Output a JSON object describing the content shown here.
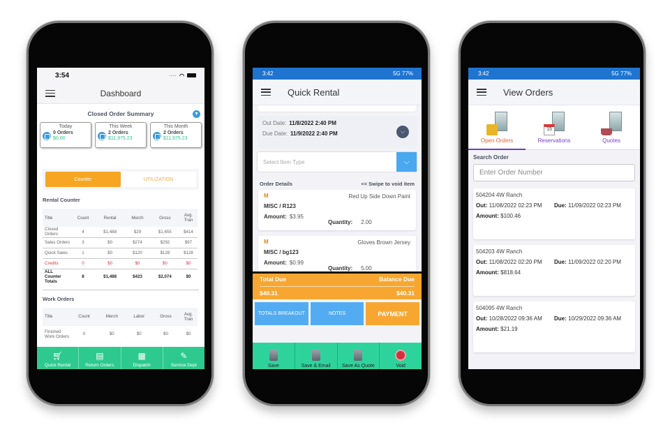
{
  "phone1": {
    "status_time": "3:54",
    "title": "Dashboard",
    "summary_title": "Closed Order Summary",
    "cards": [
      {
        "period": "Today",
        "orders": "0 Orders",
        "amount": "$0.00"
      },
      {
        "period": "This Week",
        "orders": "2 Orders",
        "amount": "$11,975.23"
      },
      {
        "period": "This Month",
        "orders": "2 Orders",
        "amount": "$11,975.23"
      }
    ],
    "segments": {
      "counter": "Counter",
      "utilization": "UTILIZATION"
    },
    "rental_counter": {
      "title": "Rental Counter",
      "headers": [
        "Title",
        "Count",
        "Rental",
        "Merch",
        "Gross",
        "Avg. Tran"
      ],
      "rows": [
        [
          "Closed Orders",
          "4",
          "$1,488",
          "$29",
          "$1,655",
          "$414"
        ],
        [
          "Sales Orders",
          "3",
          "$0",
          "$274",
          "$292",
          "$97"
        ],
        [
          "Quick Sales",
          "1",
          "$0",
          "$120",
          "$128",
          "$128"
        ],
        [
          "Credits",
          "0",
          "$0",
          "$0",
          "$0",
          "$0"
        ],
        [
          "ALL Counter Totals",
          "8",
          "$1,488",
          "$423",
          "$2,074",
          "$0"
        ]
      ]
    },
    "work_orders": {
      "title": "Work Orders",
      "headers": [
        "Title",
        "Count",
        "Merch",
        "Labor",
        "Gross",
        "Avg. Tran"
      ],
      "rows": [
        [
          "Finished Work Orders",
          "0",
          "$0",
          "$0",
          "$0",
          "$0"
        ]
      ]
    },
    "tabbar": [
      {
        "label": "Quick Rental",
        "icon": "cart-icon"
      },
      {
        "label": "Return Orders",
        "icon": "document-icon"
      },
      {
        "label": "Dispatch",
        "icon": "cash-register-icon"
      },
      {
        "label": "Service Dept",
        "icon": "chat-edit-icon"
      }
    ]
  },
  "phone2": {
    "status_time": "3:42",
    "status_right": "5G  77%",
    "title": "Quick Rental",
    "out_date_label": "Out Date:",
    "out_date": "11/8/2022 2:40 PM",
    "due_date_label": "Due Date:",
    "due_date": "11/9/2022 2:40 PM",
    "item_type_placeholder": "Select Item Type",
    "order_details_label": "Order Details",
    "swipe_hint": "<< Swipe to void item",
    "items": [
      {
        "type": "M",
        "name": "Red Up Side Down Paint",
        "sku": "MISC / R123",
        "amount_label": "Amount:",
        "amount": "$3.95",
        "quantity_label": "Quantity:",
        "quantity": "2.00"
      },
      {
        "type": "M",
        "name": "Gloves Brown Jersey",
        "sku": "MISC / bg123",
        "amount_label": "Amount:",
        "amount": "$0.99",
        "quantity_label": "Quantity:",
        "quantity": "5.00"
      }
    ],
    "total_due_label": "Total Due",
    "total_due": "$40.31",
    "balance_due_label": "Balance Due",
    "balance_due": "$40.31",
    "buttons": {
      "totals": "TOTALS BREAKOUT",
      "notes": "NOTES",
      "payment": "PAYMENT"
    },
    "tabbar": [
      {
        "label": "Save"
      },
      {
        "label": "Save & Email"
      },
      {
        "label": "Save As Quote"
      },
      {
        "label": "Void"
      }
    ]
  },
  "phone3": {
    "status_time": "3:42",
    "status_right": "5G  77%",
    "title": "View Orders",
    "tabs": [
      {
        "label": "Open Orders"
      },
      {
        "label": "Reservations"
      },
      {
        "label": "Quotes"
      }
    ],
    "search_label": "Search Order",
    "search_placeholder": "Enter Order Number",
    "orders": [
      {
        "header": "504204  4W Ranch",
        "out": "11/08/2022 02:23 PM",
        "due": "11/09/2022 02:23 PM",
        "amount": "$100.46"
      },
      {
        "header": "504203  4W Ranch",
        "out": "11/08/2022 02:20 PM",
        "due": "11/09/2022 02:20 PM",
        "amount": "$818.64"
      },
      {
        "header": "504095  4W Ranch",
        "out": "10/28/2022 09:36 AM",
        "due": "10/29/2022 09:36 AM",
        "amount": "$21.19"
      }
    ],
    "labels": {
      "out": "Out:",
      "due": "Due:",
      "amount": "Amount:"
    }
  }
}
